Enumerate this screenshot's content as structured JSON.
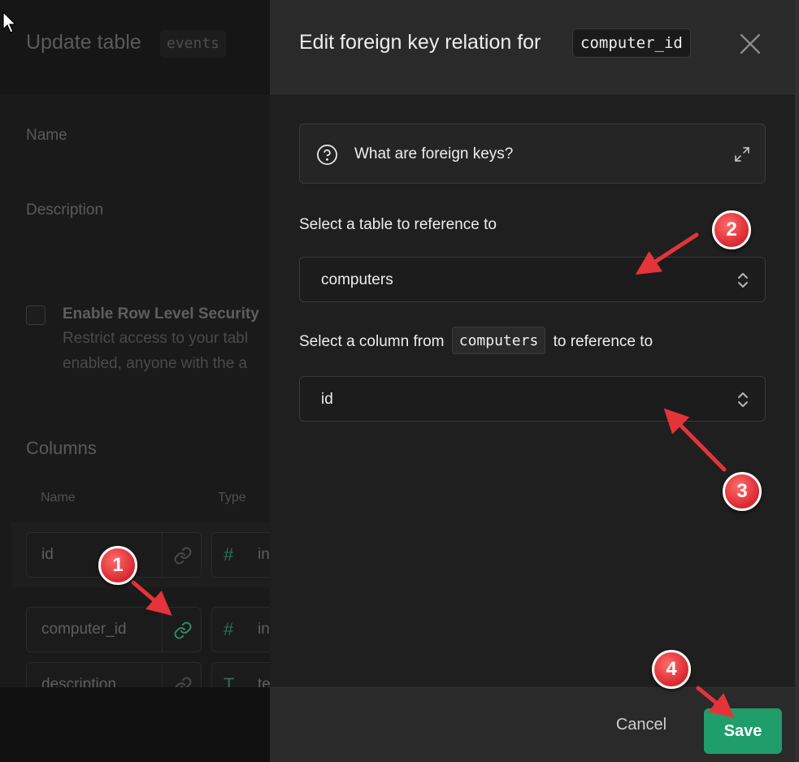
{
  "background_form": {
    "title": "Update table",
    "table_name": "events",
    "name_label": "Name",
    "description_label": "Description",
    "rls_title": "Enable Row Level Security",
    "rls_desc_line1": "Restrict access to your tabl",
    "rls_desc_line2": "enabled, anyone with the a",
    "columns_title": "Columns",
    "column_headers": [
      "Name",
      "Type"
    ],
    "rows": [
      {
        "name": "id",
        "type_icon": "#",
        "type": "in"
      },
      {
        "name": "computer_id",
        "type_icon": "#",
        "type": "in"
      },
      {
        "name": "description",
        "type_icon": "T",
        "type": "te"
      }
    ]
  },
  "dialog": {
    "title": "Edit foreign key relation for",
    "column_code": "computer_id",
    "info_text": "What are foreign keys?",
    "table_label": "Select a table to reference to",
    "table_value": "computers",
    "column_label_prefix": "Select a column from",
    "column_label_code": "computers",
    "column_label_suffix": "to reference to",
    "column_value": "id",
    "cancel_label": "Cancel",
    "save_label": "Save"
  },
  "annotations": [
    "1",
    "2",
    "3",
    "4"
  ],
  "colors": {
    "accent_green": "#1f9d6b",
    "annotation_red": "#e5333a"
  }
}
